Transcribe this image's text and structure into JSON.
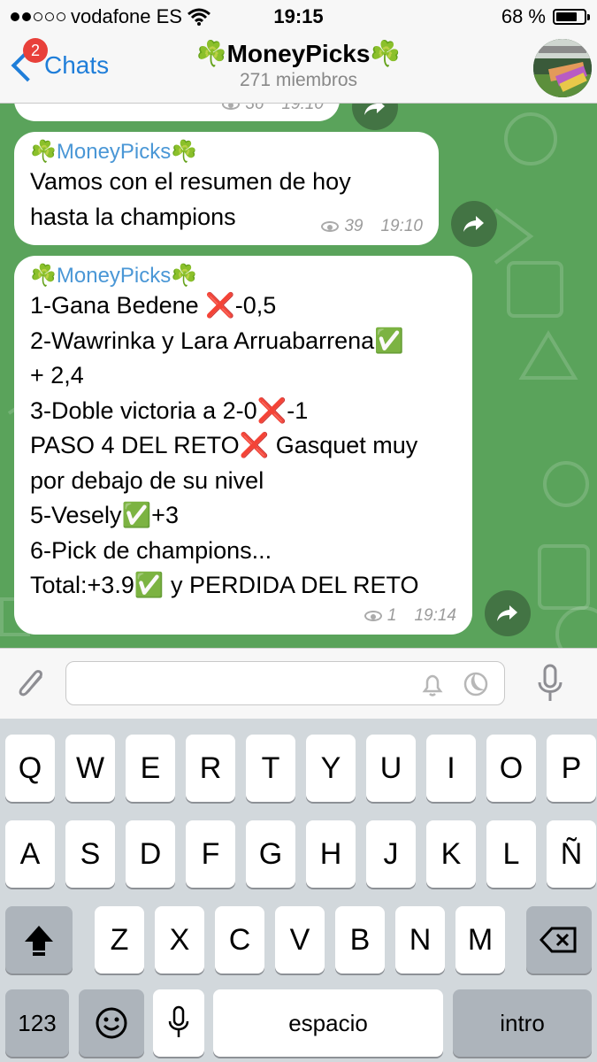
{
  "status_bar": {
    "carrier": "vodafone ES",
    "time": "19:15",
    "battery": "68 %",
    "battery_level": 0.68
  },
  "nav": {
    "back_label": "Chats",
    "back_badge": "2",
    "title": "☘️MoneyPicks☘️",
    "subtitle": "271 miembros"
  },
  "messages": [
    {
      "partial": true,
      "views": "36",
      "time": "19:10"
    },
    {
      "sender": "☘️MoneyPicks☘️",
      "text": "Vamos con el resumen de hoy\nhasta la champions",
      "views": "39",
      "time": "19:10"
    },
    {
      "sender": "☘️MoneyPicks☘️",
      "text": "1-Gana Bedene ❌-0,5\n2-Wawrinka y Lara Arruabarrena✅\n+ 2,4\n3-Doble victoria a 2-0❌-1\nPASO 4 DEL RETO❌ Gasquet muy\npor debajo de su nivel\n5-Vesely✅+3\n6-Pick de champions...\nTotal:+3.9✅ y PERDIDA DEL RETO",
      "views": "1",
      "time": "19:14"
    }
  ],
  "input": {
    "placeholder": ""
  },
  "keyboard": {
    "row1": [
      "Q",
      "W",
      "E",
      "R",
      "T",
      "Y",
      "U",
      "I",
      "O",
      "P"
    ],
    "row2": [
      "A",
      "S",
      "D",
      "F",
      "G",
      "H",
      "J",
      "K",
      "L",
      "Ñ"
    ],
    "row3": [
      "Z",
      "X",
      "C",
      "V",
      "B",
      "N",
      "M"
    ],
    "numbers_key": "123",
    "space_key": "espacio",
    "return_key": "intro"
  },
  "icons": {
    "back": "chevron-left-icon",
    "wifi": "wifi-icon",
    "views": "eye-icon",
    "forward": "share-forward-icon",
    "attach": "paperclip-icon",
    "notifications": "bell-icon",
    "timer": "moon-icon",
    "mic": "microphone-icon",
    "shift": "shift-arrow-icon",
    "delete": "backspace-icon",
    "emoji": "smiley-icon",
    "dictation": "microphone-icon"
  },
  "colors": {
    "accent": "#1f7ed9",
    "badge": "#e8403a",
    "chat_background": "#5aa35b",
    "sender_name": "#4a97d6"
  }
}
